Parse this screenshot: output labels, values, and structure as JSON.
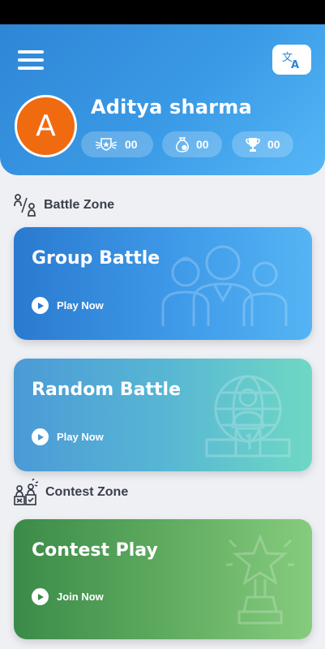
{
  "header": {
    "user_name": "Aditya sharma",
    "avatar_initial": "A",
    "stats": [
      {
        "icon": "rank-badge-icon",
        "value": "00"
      },
      {
        "icon": "coins-bag-icon",
        "value": "00"
      },
      {
        "icon": "trophy-icon",
        "value": "00"
      }
    ]
  },
  "sections": {
    "battle_zone": "Battle Zone",
    "contest_zone": "Contest Zone"
  },
  "cards": {
    "group_battle": {
      "title": "Group Battle",
      "action": "Play Now"
    },
    "random_battle": {
      "title": "Random Battle",
      "action": "Play Now"
    },
    "contest_play": {
      "title": "Contest Play",
      "action": "Join Now"
    }
  },
  "colors": {
    "header_blue": "#3a9ae6",
    "avatar_orange": "#f06a10",
    "random_teal": "#6fd8c4",
    "contest_green": "#5eaa5f"
  }
}
